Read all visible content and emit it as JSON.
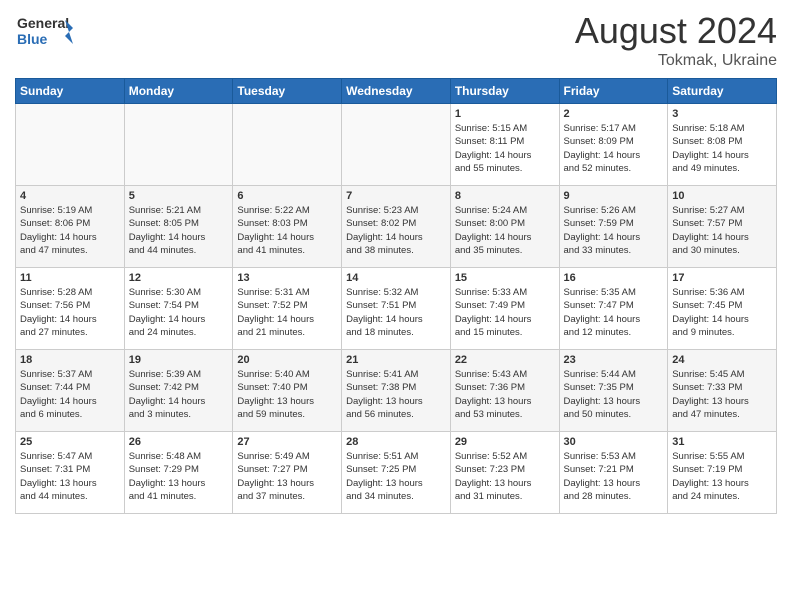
{
  "header": {
    "logo_general": "General",
    "logo_blue": "Blue",
    "month_year": "August 2024",
    "location": "Tokmak, Ukraine"
  },
  "days_of_week": [
    "Sunday",
    "Monday",
    "Tuesday",
    "Wednesday",
    "Thursday",
    "Friday",
    "Saturday"
  ],
  "weeks": [
    [
      {
        "day": "",
        "info": ""
      },
      {
        "day": "",
        "info": ""
      },
      {
        "day": "",
        "info": ""
      },
      {
        "day": "",
        "info": ""
      },
      {
        "day": "1",
        "info": "Sunrise: 5:15 AM\nSunset: 8:11 PM\nDaylight: 14 hours\nand 55 minutes."
      },
      {
        "day": "2",
        "info": "Sunrise: 5:17 AM\nSunset: 8:09 PM\nDaylight: 14 hours\nand 52 minutes."
      },
      {
        "day": "3",
        "info": "Sunrise: 5:18 AM\nSunset: 8:08 PM\nDaylight: 14 hours\nand 49 minutes."
      }
    ],
    [
      {
        "day": "4",
        "info": "Sunrise: 5:19 AM\nSunset: 8:06 PM\nDaylight: 14 hours\nand 47 minutes."
      },
      {
        "day": "5",
        "info": "Sunrise: 5:21 AM\nSunset: 8:05 PM\nDaylight: 14 hours\nand 44 minutes."
      },
      {
        "day": "6",
        "info": "Sunrise: 5:22 AM\nSunset: 8:03 PM\nDaylight: 14 hours\nand 41 minutes."
      },
      {
        "day": "7",
        "info": "Sunrise: 5:23 AM\nSunset: 8:02 PM\nDaylight: 14 hours\nand 38 minutes."
      },
      {
        "day": "8",
        "info": "Sunrise: 5:24 AM\nSunset: 8:00 PM\nDaylight: 14 hours\nand 35 minutes."
      },
      {
        "day": "9",
        "info": "Sunrise: 5:26 AM\nSunset: 7:59 PM\nDaylight: 14 hours\nand 33 minutes."
      },
      {
        "day": "10",
        "info": "Sunrise: 5:27 AM\nSunset: 7:57 PM\nDaylight: 14 hours\nand 30 minutes."
      }
    ],
    [
      {
        "day": "11",
        "info": "Sunrise: 5:28 AM\nSunset: 7:56 PM\nDaylight: 14 hours\nand 27 minutes."
      },
      {
        "day": "12",
        "info": "Sunrise: 5:30 AM\nSunset: 7:54 PM\nDaylight: 14 hours\nand 24 minutes."
      },
      {
        "day": "13",
        "info": "Sunrise: 5:31 AM\nSunset: 7:52 PM\nDaylight: 14 hours\nand 21 minutes."
      },
      {
        "day": "14",
        "info": "Sunrise: 5:32 AM\nSunset: 7:51 PM\nDaylight: 14 hours\nand 18 minutes."
      },
      {
        "day": "15",
        "info": "Sunrise: 5:33 AM\nSunset: 7:49 PM\nDaylight: 14 hours\nand 15 minutes."
      },
      {
        "day": "16",
        "info": "Sunrise: 5:35 AM\nSunset: 7:47 PM\nDaylight: 14 hours\nand 12 minutes."
      },
      {
        "day": "17",
        "info": "Sunrise: 5:36 AM\nSunset: 7:45 PM\nDaylight: 14 hours\nand 9 minutes."
      }
    ],
    [
      {
        "day": "18",
        "info": "Sunrise: 5:37 AM\nSunset: 7:44 PM\nDaylight: 14 hours\nand 6 minutes."
      },
      {
        "day": "19",
        "info": "Sunrise: 5:39 AM\nSunset: 7:42 PM\nDaylight: 14 hours\nand 3 minutes."
      },
      {
        "day": "20",
        "info": "Sunrise: 5:40 AM\nSunset: 7:40 PM\nDaylight: 13 hours\nand 59 minutes."
      },
      {
        "day": "21",
        "info": "Sunrise: 5:41 AM\nSunset: 7:38 PM\nDaylight: 13 hours\nand 56 minutes."
      },
      {
        "day": "22",
        "info": "Sunrise: 5:43 AM\nSunset: 7:36 PM\nDaylight: 13 hours\nand 53 minutes."
      },
      {
        "day": "23",
        "info": "Sunrise: 5:44 AM\nSunset: 7:35 PM\nDaylight: 13 hours\nand 50 minutes."
      },
      {
        "day": "24",
        "info": "Sunrise: 5:45 AM\nSunset: 7:33 PM\nDaylight: 13 hours\nand 47 minutes."
      }
    ],
    [
      {
        "day": "25",
        "info": "Sunrise: 5:47 AM\nSunset: 7:31 PM\nDaylight: 13 hours\nand 44 minutes."
      },
      {
        "day": "26",
        "info": "Sunrise: 5:48 AM\nSunset: 7:29 PM\nDaylight: 13 hours\nand 41 minutes."
      },
      {
        "day": "27",
        "info": "Sunrise: 5:49 AM\nSunset: 7:27 PM\nDaylight: 13 hours\nand 37 minutes."
      },
      {
        "day": "28",
        "info": "Sunrise: 5:51 AM\nSunset: 7:25 PM\nDaylight: 13 hours\nand 34 minutes."
      },
      {
        "day": "29",
        "info": "Sunrise: 5:52 AM\nSunset: 7:23 PM\nDaylight: 13 hours\nand 31 minutes."
      },
      {
        "day": "30",
        "info": "Sunrise: 5:53 AM\nSunset: 7:21 PM\nDaylight: 13 hours\nand 28 minutes."
      },
      {
        "day": "31",
        "info": "Sunrise: 5:55 AM\nSunset: 7:19 PM\nDaylight: 13 hours\nand 24 minutes."
      }
    ]
  ]
}
